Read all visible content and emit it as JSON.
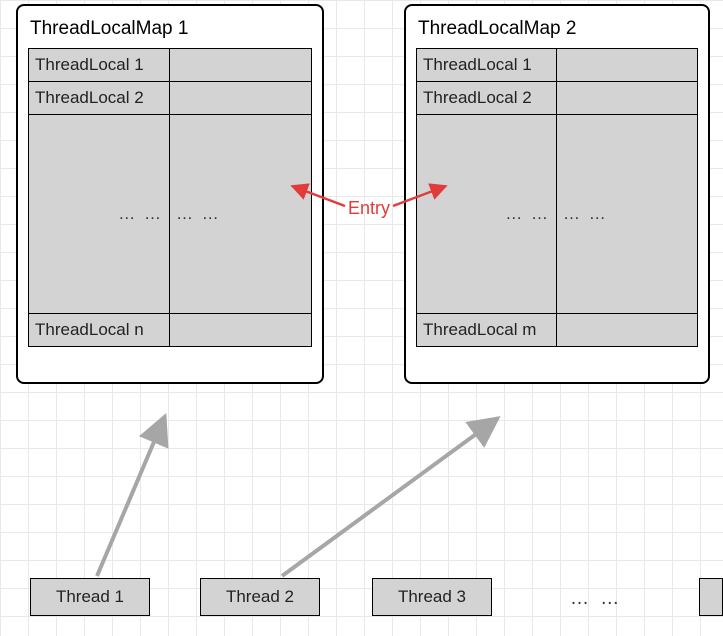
{
  "maps": [
    {
      "title": "ThreadLocalMap 1",
      "rows": [
        {
          "key": "ThreadLocal 1",
          "value": ""
        },
        {
          "key": "ThreadLocal 2",
          "value": ""
        },
        {
          "key": "… …",
          "value": "… …",
          "tall": true
        },
        {
          "key": "ThreadLocal n",
          "value": ""
        }
      ]
    },
    {
      "title": "ThreadLocalMap 2",
      "rows": [
        {
          "key": "ThreadLocal 1",
          "value": ""
        },
        {
          "key": "ThreadLocal 2",
          "value": ""
        },
        {
          "key": "… …",
          "value": "… …",
          "tall": true
        },
        {
          "key": "ThreadLocal m",
          "value": ""
        }
      ]
    }
  ],
  "entry_label": "Entry",
  "threads": [
    {
      "label": "Thread 1"
    },
    {
      "label": "Thread 2"
    },
    {
      "label": "Thread 3"
    }
  ],
  "thread_ellipsis": "… …"
}
